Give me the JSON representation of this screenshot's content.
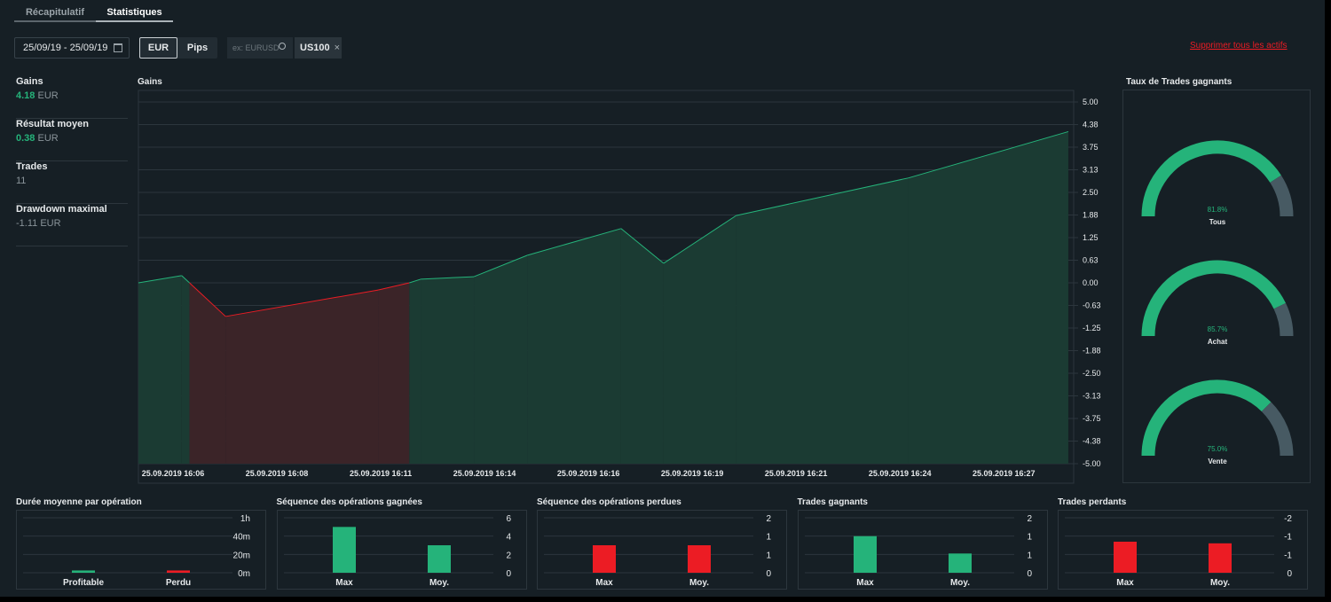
{
  "tabs": [
    {
      "label": "Récapitulatif",
      "active": false
    },
    {
      "label": "Statistiques",
      "active": true
    }
  ],
  "toolbar": {
    "date_range": "25/09/19 - 25/09/19",
    "unit_eur": "EUR",
    "unit_pips": "Pips",
    "selected_unit": "EUR",
    "search_placeholder": "ex: EURUSD",
    "asset_chip": "US100",
    "remove_all": "Supprimer tous les actifs"
  },
  "stats": [
    {
      "label": "Gains",
      "value": "4.18",
      "unit": "EUR",
      "positive": true
    },
    {
      "label": "Résultat moyen",
      "value": "0.38",
      "unit": "EUR",
      "positive": true
    },
    {
      "label": "Trades",
      "value": "11",
      "unit": "",
      "positive": false
    },
    {
      "label": "Drawdown maximal",
      "value": "-1.11",
      "unit": "EUR",
      "positive": false
    }
  ],
  "colors": {
    "green": "#25b37a",
    "red": "#ec1c24",
    "gray": "#475a63",
    "bg": "#161f25"
  },
  "chart_data": [
    {
      "type": "area",
      "title": "Gains",
      "ylim": [
        -5,
        5
      ],
      "yticks": [
        "5.00",
        "4.38",
        "3.75",
        "3.13",
        "2.50",
        "1.88",
        "1.25",
        "0.63",
        "0.00",
        "-0.63",
        "-1.25",
        "-1.88",
        "-2.50",
        "-3.13",
        "-3.75",
        "-4.38",
        "-5.00"
      ],
      "xlim": [
        "16:05:08",
        "16:28:33"
      ],
      "xticks": [
        {
          "t": "16:06",
          "label": "25.09.2019 16:06"
        },
        {
          "t": "16:08:36",
          "label": "25.09.2019 16:08"
        },
        {
          "t": "16:11:12",
          "label": "25.09.2019 16:11"
        },
        {
          "t": "16:13:48",
          "label": "25.09.2019 16:14"
        },
        {
          "t": "16:16:24",
          "label": "25.09.2019 16:16"
        },
        {
          "t": "16:19:00",
          "label": "25.09.2019 16:19"
        },
        {
          "t": "16:21:36",
          "label": "25.09.2019 16:21"
        },
        {
          "t": "16:24:12",
          "label": "25.09.2019 16:24"
        },
        {
          "t": "16:26:48",
          "label": "25.09.2019 16:27"
        }
      ],
      "x": [
        "16:05:08",
        "16:06:13",
        "16:07:19",
        "16:11:08",
        "16:11:55",
        "16:12:12",
        "16:13:32",
        "16:14:52",
        "16:17:13",
        "16:18:17",
        "16:20:06",
        "16:24:25",
        "16:28:25"
      ],
      "y": [
        0,
        0.2,
        -0.93,
        -0.2,
        0,
        0.1,
        0.17,
        0.76,
        1.5,
        0.54,
        1.86,
        2.9,
        4.18
      ]
    },
    {
      "type": "bar",
      "title": "Durée moyenne par opération",
      "categories": [
        "Profitable",
        "Perdu"
      ],
      "values": [
        2.5,
        2.5
      ],
      "unit": "min",
      "ylim": [
        0,
        60
      ],
      "yticks": [
        "0m",
        "20m",
        "40m",
        "1h"
      ],
      "colors": [
        "#25b37a",
        "#ec1c24"
      ]
    },
    {
      "type": "bar",
      "title": "Séquence des opérations gagnées",
      "categories": [
        "Max",
        "Moy."
      ],
      "values": [
        5,
        3
      ],
      "ylim": [
        0,
        6
      ],
      "yticks": [
        "0",
        "2",
        "4",
        "6"
      ],
      "colors": [
        "#25b37a",
        "#25b37a"
      ]
    },
    {
      "type": "bar",
      "title": "Séquence des opérations perdues",
      "categories": [
        "Max",
        "Moy."
      ],
      "values": [
        1,
        1
      ],
      "ylim": [
        0,
        2
      ],
      "yticks": [
        "0",
        "1",
        "1",
        "2"
      ],
      "colors": [
        "#ec1c24",
        "#ec1c24"
      ]
    },
    {
      "type": "bar",
      "title": "Trades gagnants",
      "categories": [
        "Max",
        "Moy."
      ],
      "values": [
        1.33,
        0.7
      ],
      "ylim": [
        0,
        2
      ],
      "yticks": [
        "0",
        "1",
        "1",
        "2"
      ],
      "colors": [
        "#25b37a",
        "#25b37a"
      ]
    },
    {
      "type": "bar",
      "title": "Trades perdants",
      "categories": [
        "Max",
        "Moy."
      ],
      "values": [
        -1.13,
        -1.07
      ],
      "ylim": [
        0,
        -2
      ],
      "yticks": [
        "0",
        "-1",
        "-1",
        "-2"
      ],
      "colors": [
        "#ec1c24",
        "#ec1c24"
      ]
    }
  ],
  "gauges": {
    "title": "Taux de Trades gagnants",
    "items": [
      {
        "label": "Tous",
        "value": 81.8,
        "text": "81.8%"
      },
      {
        "label": "Achat",
        "value": 85.7,
        "text": "85.7%"
      },
      {
        "label": "Vente",
        "value": 75.0,
        "text": "75.0%"
      }
    ]
  }
}
